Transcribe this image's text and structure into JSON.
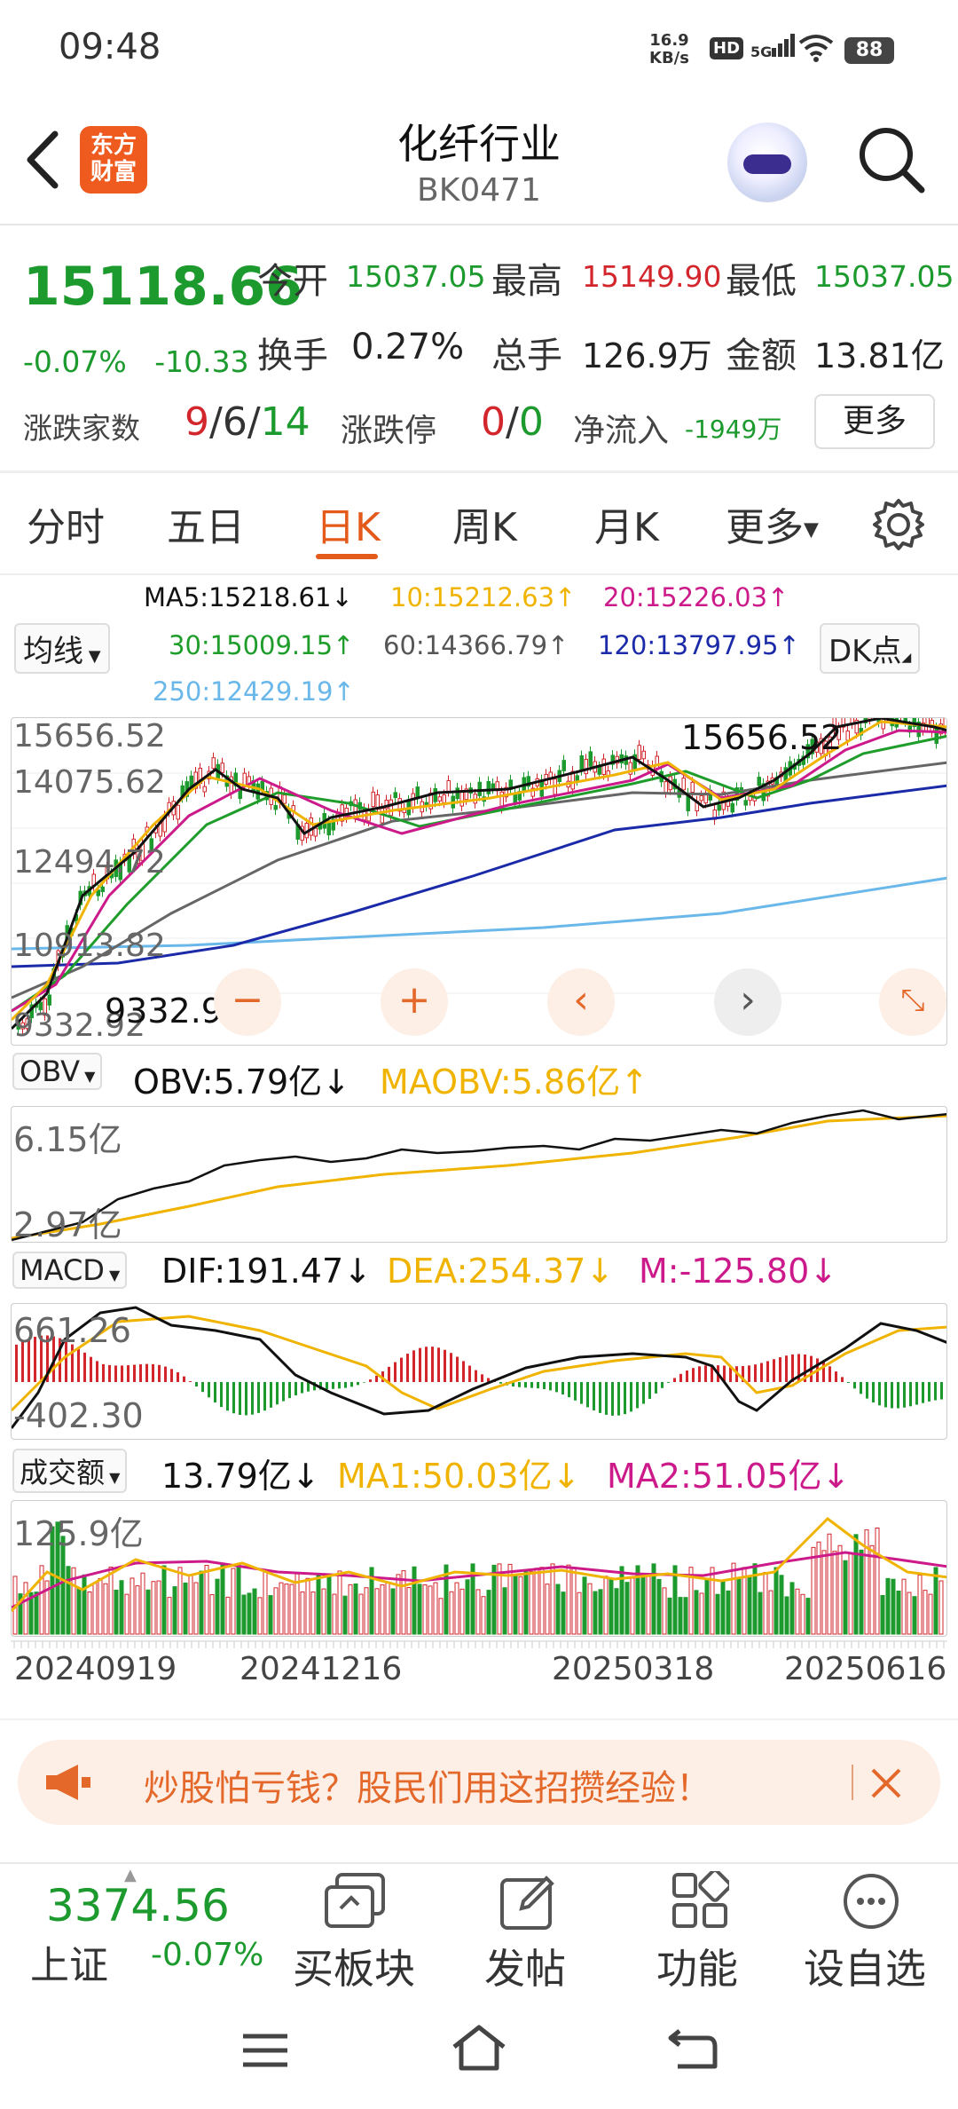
{
  "status_bar": {
    "time": "09:48",
    "net_speed": "16.9",
    "net_unit": "KB/s",
    "hd": "HD",
    "signal": "5G",
    "battery": "88"
  },
  "header": {
    "title": "化纤行业",
    "code": "BK0471",
    "logo_text": "东方财富"
  },
  "quote": {
    "price": "15118.66",
    "change_pct": "-0.07%",
    "change": "-10.33",
    "open_label": "今开",
    "open": "15037.05",
    "high_label": "最高",
    "high": "15149.90",
    "low_label": "最低",
    "low": "15037.05",
    "turnover_label": "换手",
    "turnover": "0.27%",
    "volume_label": "总手",
    "volume": "126.9万",
    "amount_label": "金额",
    "amount": "13.81亿",
    "updown_label": "涨跌家数",
    "up": "9",
    "flat": "6",
    "down": "14",
    "sep": "/",
    "limit_label": "涨跌停",
    "limit_up": "0",
    "limit_down": "0",
    "inflow_label": "净流入",
    "inflow": "-1949万",
    "more_button": "更多"
  },
  "tabs": [
    "分时",
    "五日",
    "日K",
    "周K",
    "月K",
    "更多"
  ],
  "ma": {
    "selector": "均线",
    "ma5": "MA5:15218.61↓",
    "ma10": "10:15212.63↑",
    "ma20": "20:15226.03↑",
    "ma30": "30:15009.15↑",
    "ma60": "60:14366.79↑",
    "ma120": "120:13797.95↑",
    "ma250": "250:12429.19↑",
    "dk_button": "DK点"
  },
  "kline": {
    "y_labels": [
      "15656.52",
      "14075.62",
      "12494.72",
      "10913.82",
      "9332.92"
    ],
    "max_label": "15656.52",
    "min_label": "9332.92"
  },
  "obv": {
    "selector": "OBV",
    "value": "OBV:5.79亿↓",
    "ma": "MAOBV:5.86亿↑",
    "y_top": "6.15亿",
    "y_bottom": "2.97亿"
  },
  "macd": {
    "selector": "MACD",
    "dif": "DIF:191.47↓",
    "dea": "DEA:254.37↓",
    "m": "M:-125.80↓",
    "y_top": "661.26",
    "y_bottom": "-402.30"
  },
  "turnover_chart": {
    "selector": "成交额",
    "value": "13.79亿↓",
    "ma1": "MA1:50.03亿↓",
    "ma2": "MA2:51.05亿↓",
    "y_top": "125.9亿"
  },
  "dates": [
    "20240919",
    "20241216",
    "20250318",
    "20250616"
  ],
  "banner": {
    "text": "炒股怕亏钱？股民们用这招攒经验！"
  },
  "bottom": {
    "index_value": "3374.56",
    "index_name": "上证",
    "index_change": "-0.07%",
    "buttons": [
      "买板块",
      "发帖",
      "功能",
      "设自选"
    ]
  },
  "colors": {
    "up": "#d3262c",
    "down": "#1c9a2d",
    "accent": "#e35a1b",
    "ma5": "#111111",
    "ma10": "#f0b400",
    "ma20": "#cc1a8a",
    "ma30": "#1f9d2b",
    "ma60": "#666666",
    "ma120": "#1a2aa8",
    "ma250": "#6ab8ea"
  }
}
